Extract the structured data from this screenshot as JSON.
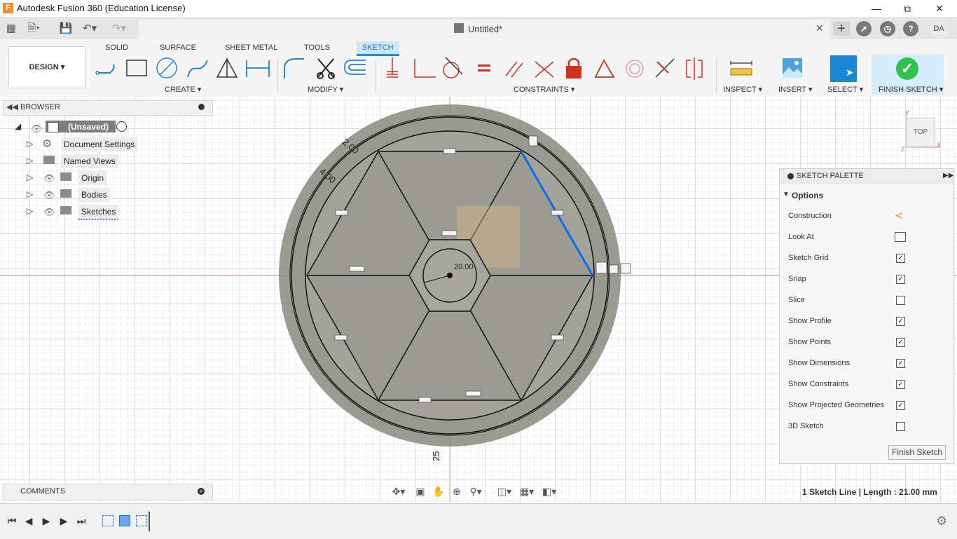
{
  "app": {
    "title": "Autodesk Fusion 360 (Education License)",
    "logo": "F"
  },
  "document": {
    "title": "Untitled*"
  },
  "user": {
    "initials": "DA"
  },
  "ribbon": {
    "design_label": "DESIGN",
    "workspace_tabs": [
      "SOLID",
      "SURFACE",
      "SHEET METAL",
      "TOOLS",
      "SKETCH"
    ],
    "groups": {
      "create": "CREATE",
      "modify": "MODIFY",
      "constraints": "CONSTRAINTS",
      "inspect": "INSPECT",
      "insert": "INSERT",
      "select": "SELECT",
      "finish": "FINISH SKETCH"
    }
  },
  "browser": {
    "title": "BROWSER",
    "root": "(Unsaved)",
    "items": [
      "Document Settings",
      "Named Views",
      "Origin",
      "Bodies",
      "Sketches"
    ]
  },
  "comments": {
    "title": "COMMENTS"
  },
  "viewcube": {
    "face": "TOP"
  },
  "sketch_dims": {
    "d1": "2.00",
    "d2": "4.00",
    "d3": "25",
    "center": "20.00"
  },
  "palette": {
    "title": "SKETCH PALETTE",
    "section": "Options",
    "rows": [
      {
        "label": "Construction",
        "kind": "icon"
      },
      {
        "label": "Look At",
        "kind": "icon"
      },
      {
        "label": "Sketch Grid",
        "checked": true
      },
      {
        "label": "Snap",
        "checked": true
      },
      {
        "label": "Slice",
        "checked": false
      },
      {
        "label": "Show Profile",
        "checked": true
      },
      {
        "label": "Show Points",
        "checked": true
      },
      {
        "label": "Show Dimensions",
        "checked": true
      },
      {
        "label": "Show Constraints",
        "checked": true
      },
      {
        "label": "Show Projected Geometries",
        "checked": true
      },
      {
        "label": "3D Sketch",
        "checked": false
      }
    ],
    "finish_button": "Finish Sketch"
  },
  "status": {
    "text": "1 Sketch Line | Length : 21.00 mm"
  },
  "colors": {
    "accent": "#1a87d4",
    "finish_green": "#31c24b",
    "selection_blue": "#0a6fe6"
  }
}
